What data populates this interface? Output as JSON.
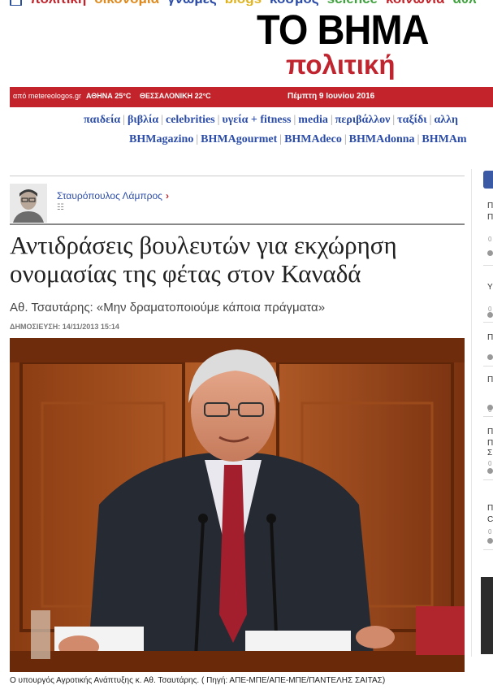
{
  "top_sections": [
    {
      "label": "πολιτική",
      "color": "#c3232a"
    },
    {
      "label": "οικονομία",
      "color": "#e08a1e"
    },
    {
      "label": "γνώμες",
      "color": "#2b4ca8"
    },
    {
      "label": "blogs",
      "color": "#e0b31e"
    },
    {
      "label": "κόσμος",
      "color": "#2b4ca8"
    },
    {
      "label": "science",
      "color": "#3ea33c"
    },
    {
      "label": "κοινωνία",
      "color": "#c3232a"
    },
    {
      "label": "αθλ",
      "color": "#3ea33c"
    }
  ],
  "logo": {
    "title": "ΤΟ ΒΗΜΑ",
    "section": "πολιτική"
  },
  "weather": {
    "source": "από metereologos.gr",
    "city1": "ΑΘΗΝΑ  25°C",
    "city2": "ΘΕΣΣΑΛΟΝΙΚΗ  22°C"
  },
  "date": "Πέμπτη 9 Ιουνίου 2016",
  "nav_row1": [
    "παιδεία",
    "βιβλία",
    "celebrities",
    "υγεία + fitness",
    "media",
    "περιβάλλον",
    "ταξίδι",
    "αλλη"
  ],
  "nav_row2": [
    "BHMagazino",
    "BHMAgourmet",
    "BHMAdeco",
    "BHMAdonna",
    "BHMAm"
  ],
  "author": {
    "name": "Σταυρόπουλος Λάμπρος",
    "chevron": "›",
    "rss": "☷"
  },
  "article": {
    "headline": "Αντιδράσεις βουλευτών για εκχώρηση ονομασίας της φέτας στον Καναδά",
    "subtitle": "Αθ. Τσαυτάρης: «Μην δραματοποιούμε κάποια πράγματα»",
    "published": "ΔΗΜΟΣΙΕΥΣΗ:  14/11/2013 15:14",
    "caption": "Ο υπουργός Αγροτικής Ανάπτυξης κ. Αθ. Τσαυτάρης. ( Πηγή: ΑΠΕ-ΜΠΕ/ΑΠΕ-ΜΠΕ/ΠΑΝΤΕΛΗΣ ΣΑΙΤΑΣ)"
  },
  "sidebar_chars": [
    "Π",
    "Π",
    "Υ",
    "Π",
    "Π",
    "Π",
    "Π",
    "Σ",
    "Π",
    "C"
  ],
  "sidebar_nums": [
    "0",
    "0",
    "0",
    "0",
    "0"
  ],
  "colors": {
    "accent_red": "#c3232a",
    "link_blue": "#2b4ca8"
  }
}
